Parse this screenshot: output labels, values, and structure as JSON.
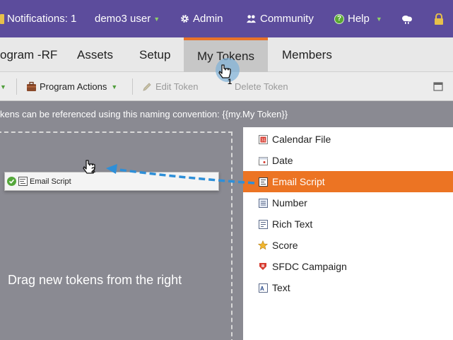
{
  "topbar": {
    "notifications": "Notifications: 1",
    "user": "demo3 user",
    "admin": "Admin",
    "community": "Community",
    "help": "Help"
  },
  "tabs": [
    {
      "label": "ogram -RF"
    },
    {
      "label": "Assets"
    },
    {
      "label": "Setup"
    },
    {
      "label": "My Tokens"
    },
    {
      "label": "Members"
    }
  ],
  "toolbar": {
    "program_actions": "Program Actions",
    "edit_token": "Edit Token",
    "delete_token": "Delete Token"
  },
  "banner": {
    "text": "kens can be referenced using this naming convention: {{my.My Token}}"
  },
  "droparea": {
    "hint": "Drag new tokens from the right",
    "dragged_token": "Email Script"
  },
  "tokens": [
    {
      "label": "Calendar File",
      "icon": "calendar-file-icon"
    },
    {
      "label": "Date",
      "icon": "date-icon"
    },
    {
      "label": "Email Script",
      "icon": "email-script-icon"
    },
    {
      "label": "Number",
      "icon": "number-icon"
    },
    {
      "label": "Rich Text",
      "icon": "rich-text-icon"
    },
    {
      "label": "Score",
      "icon": "score-icon"
    },
    {
      "label": "SFDC Campaign",
      "icon": "sfdc-campaign-icon"
    },
    {
      "label": "Text",
      "icon": "text-icon"
    }
  ],
  "steps": {
    "step1": "1",
    "step2": "2"
  },
  "colors": {
    "topbar": "#5c4c9c",
    "accent": "#ec7423",
    "drop_bg": "#8a8a92"
  }
}
